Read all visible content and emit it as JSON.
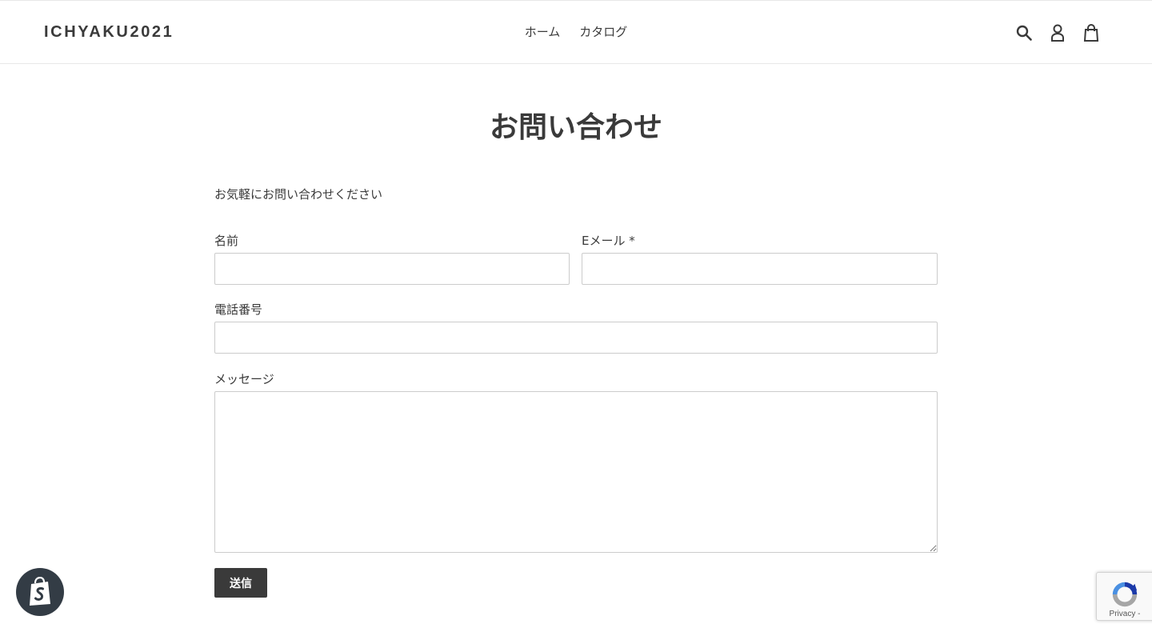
{
  "header": {
    "logo": "ICHYAKU2021",
    "nav": [
      {
        "label": "ホーム"
      },
      {
        "label": "カタログ"
      }
    ],
    "icons": [
      "search-icon",
      "account-icon",
      "cart-icon"
    ]
  },
  "page": {
    "title": "お問い合わせ",
    "intro": "お気軽にお問い合わせください"
  },
  "form": {
    "name_label": "名前",
    "name_value": "",
    "email_label": "Eメール *",
    "email_value": "",
    "phone_label": "電話番号",
    "phone_value": "",
    "message_label": "メッセージ",
    "message_value": "",
    "submit_label": "送信"
  },
  "widgets": {
    "shopify_badge_icon": "shopify-bag-icon",
    "recaptcha_icon": "recaptcha-icon",
    "recaptcha_text": "Privacy -"
  },
  "colors": {
    "text": "#3a3a3a",
    "button_bg": "#3a3a3a",
    "badge_bg": "#333c45",
    "border": "#cccccc"
  }
}
